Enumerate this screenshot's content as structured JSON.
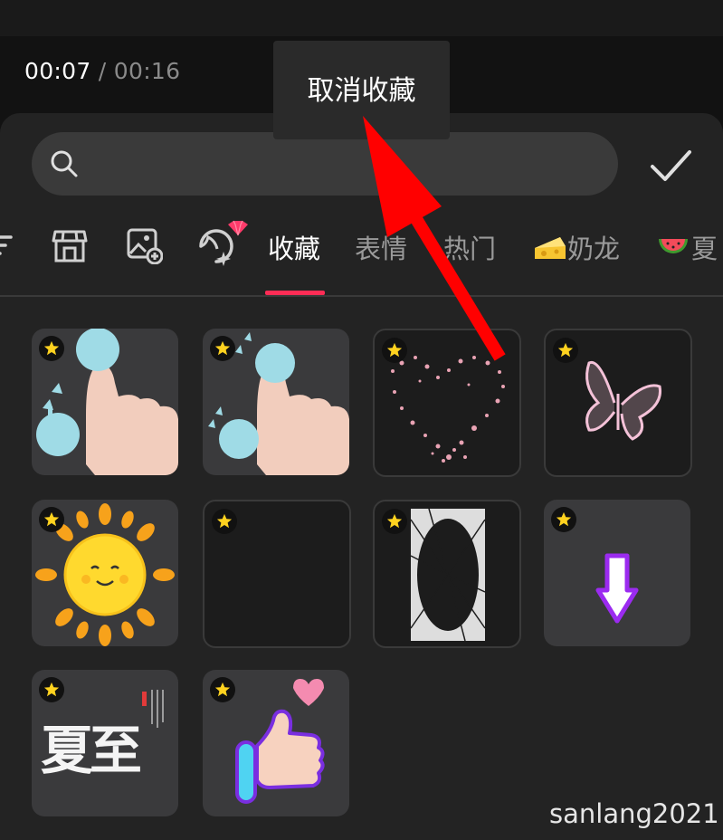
{
  "player": {
    "current_time": "00:07",
    "separator": "/",
    "total_time": "00:16"
  },
  "search": {
    "placeholder": "",
    "value": ""
  },
  "tabs": [
    {
      "id": "filter",
      "label": "",
      "icon": "filter-icon"
    },
    {
      "id": "store",
      "label": "",
      "icon": "store-icon"
    },
    {
      "id": "add-image",
      "label": "",
      "icon": "image-add-icon"
    },
    {
      "id": "custom",
      "label": "",
      "icon": "sticker-diamond-icon"
    },
    {
      "id": "favorites",
      "label": "收藏",
      "active": true
    },
    {
      "id": "emoji",
      "label": "表情"
    },
    {
      "id": "hot",
      "label": "热门"
    },
    {
      "id": "naillong",
      "label": "奶龙",
      "icon": "cheese-icon"
    },
    {
      "id": "summer",
      "label": "夏",
      "icon": "watermelon-icon"
    }
  ],
  "stickers": [
    {
      "name": "two-finger-zoom-out",
      "favorited": true
    },
    {
      "name": "two-finger-zoom-in",
      "favorited": true
    },
    {
      "name": "heart-particles",
      "favorited": true
    },
    {
      "name": "glowing-butterfly",
      "favorited": true
    },
    {
      "name": "smiling-sun",
      "favorited": true
    },
    {
      "name": "blank-sticker",
      "favorited": true
    },
    {
      "name": "speed-lines-frame",
      "favorited": true
    },
    {
      "name": "purple-down-arrow",
      "favorited": true
    },
    {
      "name": "summer-solstice-calligraphy",
      "favorited": true,
      "text": "夏至"
    },
    {
      "name": "thumbs-up-heart",
      "favorited": true
    }
  ],
  "tooltip": {
    "label": "取消收藏"
  },
  "watermark": "sanlang2021",
  "colors": {
    "accent": "#fe2c55",
    "star": "#ffd21f",
    "arrow": "#ff0000"
  }
}
